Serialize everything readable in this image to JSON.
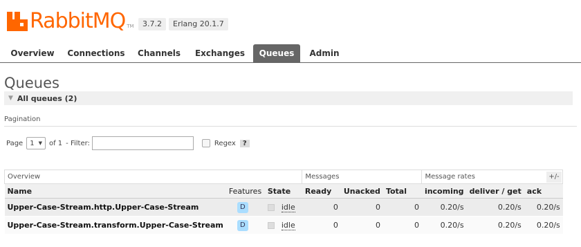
{
  "header": {
    "logo_text": "RabbitMQ",
    "logo_tm": "TM",
    "version": "3.7.2",
    "erlang": "Erlang 20.1.7"
  },
  "tabs": [
    {
      "label": "Overview",
      "active": false
    },
    {
      "label": "Connections",
      "active": false
    },
    {
      "label": "Channels",
      "active": false
    },
    {
      "label": "Exchanges",
      "active": false
    },
    {
      "label": "Queues",
      "active": true
    },
    {
      "label": "Admin",
      "active": false
    }
  ],
  "page_title": "Queues",
  "section": {
    "label": "All queues (2)"
  },
  "pagination": {
    "title": "Pagination",
    "page_label": "Page",
    "page_value": "1",
    "of_label": "of 1",
    "filter_label": "- Filter:",
    "filter_value": "",
    "regex_label": "Regex",
    "help": "?"
  },
  "table": {
    "groups": [
      "Overview",
      "Messages",
      "Message rates"
    ],
    "columns": [
      "Name",
      "Features",
      "State",
      "Ready",
      "Unacked",
      "Total",
      "incoming",
      "deliver / get",
      "ack"
    ],
    "plus_minus": "+/-",
    "rows": [
      {
        "name": "Upper-Case-Stream.http.Upper-Case-Stream",
        "feature": "D",
        "state": "idle",
        "ready": "0",
        "unacked": "0",
        "total": "0",
        "incoming": "0.20/s",
        "deliver": "0.20/s",
        "ack": "0.20/s"
      },
      {
        "name": "Upper-Case-Stream.transform.Upper-Case-Stream",
        "feature": "D",
        "state": "idle",
        "ready": "0",
        "unacked": "0",
        "total": "0",
        "incoming": "0.20/s",
        "deliver": "0.20/s",
        "ack": "0.20/s"
      }
    ]
  }
}
